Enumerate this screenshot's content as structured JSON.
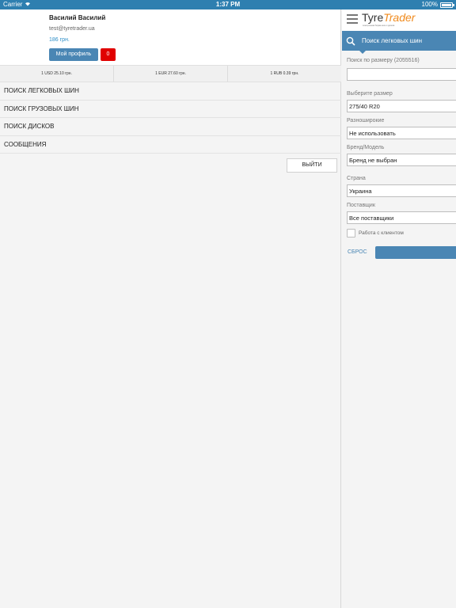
{
  "statusbar": {
    "carrier": "Carrier",
    "time": "1:37 PM",
    "battery": "100%",
    "battery_level": 1.0
  },
  "drawer": {
    "profile": {
      "name": "Василий Василий",
      "email": "test@tyretrader.ua",
      "balance": "186 грн.",
      "profile_button": "Мой профиль",
      "messages_count": "0"
    },
    "rates": [
      "1 USD 25.10 грн.",
      "1 EUR 27.60 грн.",
      "1 RUB 0.39 грн."
    ],
    "menu": [
      "ПОИСК ЛЕГКОВЫХ ШИН",
      "ПОИСК ГРУЗОВЫХ ШИН",
      "ПОИСК ДИСКОВ",
      "СООБЩЕНИЯ"
    ],
    "logout": "ВЫЙТИ"
  },
  "panel": {
    "logo_tyre": "Tyre",
    "logo_trader": "Trader",
    "logo_sub": "электронная биржа шин и дисков",
    "header_title": "Поиск легковых шин",
    "size_search_label": "Поиск по размеру (2055516)",
    "size_search_value": "",
    "size_label": "Выберите размер",
    "size_value": "275/40 R20",
    "wide_label": "Разноширокие",
    "wide_value": "Не использовать",
    "brand_label": "Бренд/Модель",
    "brand_value": "Бренд не выбран",
    "country_label": "Страна",
    "country_value": "Украина",
    "supplier_label": "Поставщик",
    "supplier_value": "Все поставщики",
    "client_checkbox_label": "Работа с клиентом",
    "reset_label": "СБРОС"
  },
  "colors": {
    "accent": "#4a86b4",
    "status_bar": "#2e7fb0",
    "danger": "#e00000",
    "logo_orange": "#f08a1c"
  }
}
